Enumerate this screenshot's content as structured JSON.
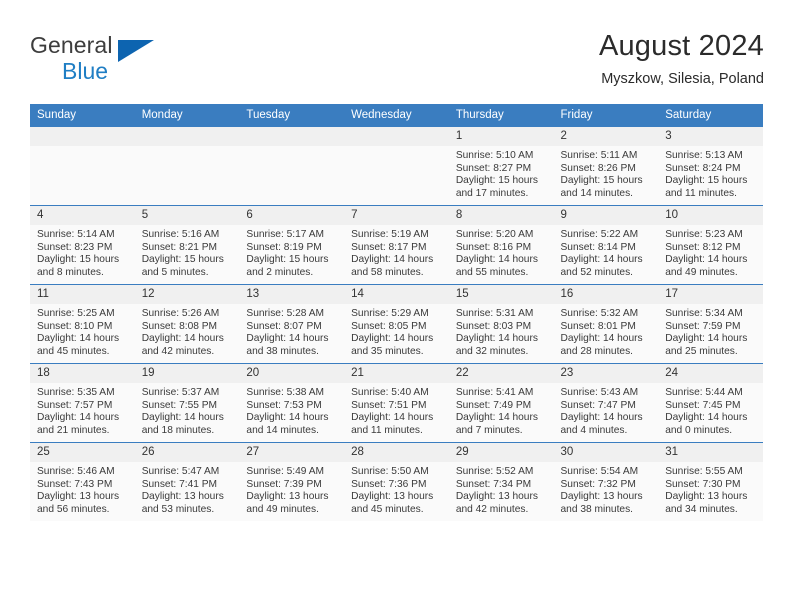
{
  "brand": {
    "name_part1": "General",
    "name_part2": "Blue",
    "triangle_icon": "triangle-logo-icon"
  },
  "header": {
    "month_title": "August 2024",
    "location": "Myszkow, Silesia, Poland"
  },
  "calendar": {
    "weekday_headers": [
      "Sunday",
      "Monday",
      "Tuesday",
      "Wednesday",
      "Thursday",
      "Friday",
      "Saturday"
    ],
    "accent_color": "#3a7dc0",
    "daynum_bg": "#f0f0f0",
    "weeks": [
      [
        {
          "day": "",
          "empty": true,
          "sunrise": "",
          "sunset": "",
          "daylight1": "",
          "daylight2": ""
        },
        {
          "day": "",
          "empty": true,
          "sunrise": "",
          "sunset": "",
          "daylight1": "",
          "daylight2": ""
        },
        {
          "day": "",
          "empty": true,
          "sunrise": "",
          "sunset": "",
          "daylight1": "",
          "daylight2": ""
        },
        {
          "day": "",
          "empty": true,
          "sunrise": "",
          "sunset": "",
          "daylight1": "",
          "daylight2": ""
        },
        {
          "day": "1",
          "sunrise": "Sunrise: 5:10 AM",
          "sunset": "Sunset: 8:27 PM",
          "daylight1": "Daylight: 15 hours",
          "daylight2": "and 17 minutes."
        },
        {
          "day": "2",
          "sunrise": "Sunrise: 5:11 AM",
          "sunset": "Sunset: 8:26 PM",
          "daylight1": "Daylight: 15 hours",
          "daylight2": "and 14 minutes."
        },
        {
          "day": "3",
          "sunrise": "Sunrise: 5:13 AM",
          "sunset": "Sunset: 8:24 PM",
          "daylight1": "Daylight: 15 hours",
          "daylight2": "and 11 minutes."
        }
      ],
      [
        {
          "day": "4",
          "sunrise": "Sunrise: 5:14 AM",
          "sunset": "Sunset: 8:23 PM",
          "daylight1": "Daylight: 15 hours",
          "daylight2": "and 8 minutes."
        },
        {
          "day": "5",
          "sunrise": "Sunrise: 5:16 AM",
          "sunset": "Sunset: 8:21 PM",
          "daylight1": "Daylight: 15 hours",
          "daylight2": "and 5 minutes."
        },
        {
          "day": "6",
          "sunrise": "Sunrise: 5:17 AM",
          "sunset": "Sunset: 8:19 PM",
          "daylight1": "Daylight: 15 hours",
          "daylight2": "and 2 minutes."
        },
        {
          "day": "7",
          "sunrise": "Sunrise: 5:19 AM",
          "sunset": "Sunset: 8:17 PM",
          "daylight1": "Daylight: 14 hours",
          "daylight2": "and 58 minutes."
        },
        {
          "day": "8",
          "sunrise": "Sunrise: 5:20 AM",
          "sunset": "Sunset: 8:16 PM",
          "daylight1": "Daylight: 14 hours",
          "daylight2": "and 55 minutes."
        },
        {
          "day": "9",
          "sunrise": "Sunrise: 5:22 AM",
          "sunset": "Sunset: 8:14 PM",
          "daylight1": "Daylight: 14 hours",
          "daylight2": "and 52 minutes."
        },
        {
          "day": "10",
          "sunrise": "Sunrise: 5:23 AM",
          "sunset": "Sunset: 8:12 PM",
          "daylight1": "Daylight: 14 hours",
          "daylight2": "and 49 minutes."
        }
      ],
      [
        {
          "day": "11",
          "sunrise": "Sunrise: 5:25 AM",
          "sunset": "Sunset: 8:10 PM",
          "daylight1": "Daylight: 14 hours",
          "daylight2": "and 45 minutes."
        },
        {
          "day": "12",
          "sunrise": "Sunrise: 5:26 AM",
          "sunset": "Sunset: 8:08 PM",
          "daylight1": "Daylight: 14 hours",
          "daylight2": "and 42 minutes."
        },
        {
          "day": "13",
          "sunrise": "Sunrise: 5:28 AM",
          "sunset": "Sunset: 8:07 PM",
          "daylight1": "Daylight: 14 hours",
          "daylight2": "and 38 minutes."
        },
        {
          "day": "14",
          "sunrise": "Sunrise: 5:29 AM",
          "sunset": "Sunset: 8:05 PM",
          "daylight1": "Daylight: 14 hours",
          "daylight2": "and 35 minutes."
        },
        {
          "day": "15",
          "sunrise": "Sunrise: 5:31 AM",
          "sunset": "Sunset: 8:03 PM",
          "daylight1": "Daylight: 14 hours",
          "daylight2": "and 32 minutes."
        },
        {
          "day": "16",
          "sunrise": "Sunrise: 5:32 AM",
          "sunset": "Sunset: 8:01 PM",
          "daylight1": "Daylight: 14 hours",
          "daylight2": "and 28 minutes."
        },
        {
          "day": "17",
          "sunrise": "Sunrise: 5:34 AM",
          "sunset": "Sunset: 7:59 PM",
          "daylight1": "Daylight: 14 hours",
          "daylight2": "and 25 minutes."
        }
      ],
      [
        {
          "day": "18",
          "sunrise": "Sunrise: 5:35 AM",
          "sunset": "Sunset: 7:57 PM",
          "daylight1": "Daylight: 14 hours",
          "daylight2": "and 21 minutes."
        },
        {
          "day": "19",
          "sunrise": "Sunrise: 5:37 AM",
          "sunset": "Sunset: 7:55 PM",
          "daylight1": "Daylight: 14 hours",
          "daylight2": "and 18 minutes."
        },
        {
          "day": "20",
          "sunrise": "Sunrise: 5:38 AM",
          "sunset": "Sunset: 7:53 PM",
          "daylight1": "Daylight: 14 hours",
          "daylight2": "and 14 minutes."
        },
        {
          "day": "21",
          "sunrise": "Sunrise: 5:40 AM",
          "sunset": "Sunset: 7:51 PM",
          "daylight1": "Daylight: 14 hours",
          "daylight2": "and 11 minutes."
        },
        {
          "day": "22",
          "sunrise": "Sunrise: 5:41 AM",
          "sunset": "Sunset: 7:49 PM",
          "daylight1": "Daylight: 14 hours",
          "daylight2": "and 7 minutes."
        },
        {
          "day": "23",
          "sunrise": "Sunrise: 5:43 AM",
          "sunset": "Sunset: 7:47 PM",
          "daylight1": "Daylight: 14 hours",
          "daylight2": "and 4 minutes."
        },
        {
          "day": "24",
          "sunrise": "Sunrise: 5:44 AM",
          "sunset": "Sunset: 7:45 PM",
          "daylight1": "Daylight: 14 hours",
          "daylight2": "and 0 minutes."
        }
      ],
      [
        {
          "day": "25",
          "sunrise": "Sunrise: 5:46 AM",
          "sunset": "Sunset: 7:43 PM",
          "daylight1": "Daylight: 13 hours",
          "daylight2": "and 56 minutes."
        },
        {
          "day": "26",
          "sunrise": "Sunrise: 5:47 AM",
          "sunset": "Sunset: 7:41 PM",
          "daylight1": "Daylight: 13 hours",
          "daylight2": "and 53 minutes."
        },
        {
          "day": "27",
          "sunrise": "Sunrise: 5:49 AM",
          "sunset": "Sunset: 7:39 PM",
          "daylight1": "Daylight: 13 hours",
          "daylight2": "and 49 minutes."
        },
        {
          "day": "28",
          "sunrise": "Sunrise: 5:50 AM",
          "sunset": "Sunset: 7:36 PM",
          "daylight1": "Daylight: 13 hours",
          "daylight2": "and 45 minutes."
        },
        {
          "day": "29",
          "sunrise": "Sunrise: 5:52 AM",
          "sunset": "Sunset: 7:34 PM",
          "daylight1": "Daylight: 13 hours",
          "daylight2": "and 42 minutes."
        },
        {
          "day": "30",
          "sunrise": "Sunrise: 5:54 AM",
          "sunset": "Sunset: 7:32 PM",
          "daylight1": "Daylight: 13 hours",
          "daylight2": "and 38 minutes."
        },
        {
          "day": "31",
          "sunrise": "Sunrise: 5:55 AM",
          "sunset": "Sunset: 7:30 PM",
          "daylight1": "Daylight: 13 hours",
          "daylight2": "and 34 minutes."
        }
      ]
    ]
  }
}
